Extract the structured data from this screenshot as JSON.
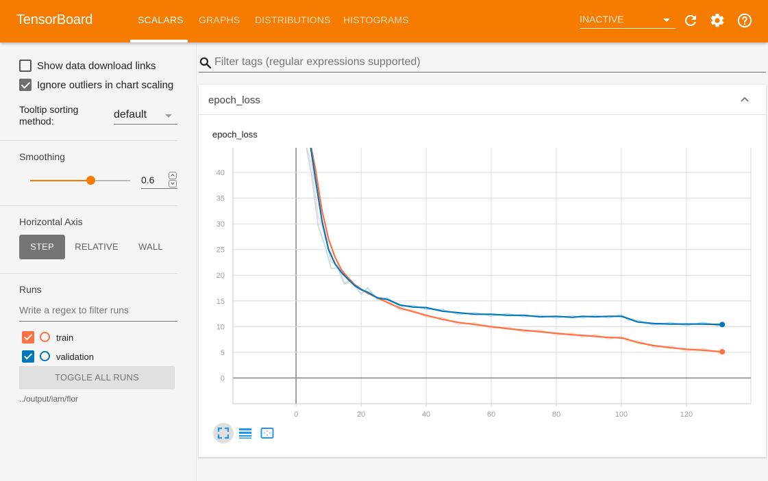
{
  "header": {
    "brand": "TensorBoard",
    "tabs": [
      {
        "label": "SCALARS",
        "active": true
      },
      {
        "label": "GRAPHS",
        "active": false
      },
      {
        "label": "DISTRIBUTIONS",
        "active": false
      },
      {
        "label": "HISTOGRAMS",
        "active": false
      }
    ],
    "run_selector": "INACTIVE",
    "icons": [
      "refresh-icon",
      "gear-icon",
      "help-icon"
    ]
  },
  "sidebar": {
    "show_download_links": {
      "label": "Show data download links",
      "checked": false
    },
    "ignore_outliers": {
      "label": "Ignore outliers in chart scaling",
      "checked": true
    },
    "tooltip_sorting": {
      "label_line1": "Tooltip sorting",
      "label_line2": "method:",
      "value": "default"
    },
    "smoothing": {
      "title": "Smoothing",
      "value": "0.6",
      "fraction": 0.6
    },
    "horizontal_axis": {
      "title": "Horizontal Axis",
      "options": [
        {
          "label": "STEP",
          "active": true
        },
        {
          "label": "RELATIVE",
          "active": false
        },
        {
          "label": "WALL",
          "active": false
        }
      ]
    },
    "runs": {
      "title": "Runs",
      "filter_placeholder": "Write a regex to filter runs",
      "items": [
        {
          "name": "train",
          "checked": true,
          "color": "#ff7043"
        },
        {
          "name": "validation",
          "checked": true,
          "color": "#0077bb"
        }
      ],
      "toggle_all_label": "TOGGLE ALL RUNS",
      "logdir": "../output/iam/flor"
    }
  },
  "main": {
    "tag_filter_placeholder": "Filter tags (regular expressions supported)",
    "card": {
      "title": "epoch_loss",
      "chart_title": "epoch_loss",
      "actions": [
        "fit-domain-icon",
        "toggle-log-scale-icon",
        "expand-chart-icon"
      ]
    }
  },
  "chart_data": {
    "type": "line",
    "title": "epoch_loss",
    "xlabel": "",
    "ylabel": "",
    "xlim": [
      -19.4,
      139.8
    ],
    "ylim": [
      -5,
      44.8
    ],
    "xticks": [
      0,
      20,
      40,
      60,
      80,
      100,
      120
    ],
    "yticks": [
      0,
      5,
      10,
      15,
      20,
      25,
      30,
      35,
      40
    ],
    "grid": true,
    "smoothing": 0.6,
    "series": [
      {
        "name": "train",
        "color": "#ff7043",
        "x": [
          4,
          6,
          8,
          10,
          12,
          14,
          16,
          18,
          20,
          22,
          25,
          28,
          32,
          36,
          40,
          45,
          50,
          55,
          60,
          65,
          70,
          75,
          80,
          85,
          88,
          92,
          96,
          100,
          102,
          105,
          110,
          115,
          120,
          125,
          131
        ],
        "smoothed": [
          47,
          40.5,
          32.5,
          27,
          23.5,
          21,
          19.5,
          18.2,
          17.3,
          16.5,
          15.6,
          14.7,
          13.6,
          12.9,
          12.2,
          11.4,
          10.8,
          10.4,
          10.0,
          9.6,
          9.3,
          9.0,
          8.7,
          8.4,
          8.3,
          8.1,
          7.9,
          7.8,
          7.5,
          6.9,
          6.3,
          5.9,
          5.6,
          5.4,
          5.1
        ]
      },
      {
        "name": "validation",
        "color": "#0077bb",
        "x": [
          4,
          6,
          8,
          10,
          12,
          14,
          16,
          18,
          20,
          22,
          25,
          28,
          32,
          36,
          40,
          45,
          50,
          55,
          60,
          65,
          70,
          75,
          80,
          85,
          88,
          92,
          96,
          100,
          102,
          105,
          110,
          115,
          120,
          125,
          131
        ],
        "smoothed": [
          47,
          38.5,
          30.5,
          25,
          22.2,
          20.5,
          19.2,
          18.0,
          17.2,
          16.7,
          15.6,
          15.3,
          14.2,
          13.8,
          13.7,
          13.0,
          12.7,
          12.4,
          12.4,
          12.2,
          12.2,
          11.9,
          12.0,
          11.8,
          12.0,
          11.9,
          12.0,
          12.0,
          11.6,
          10.9,
          10.6,
          10.5,
          10.5,
          10.5,
          10.4
        ]
      }
    ]
  }
}
